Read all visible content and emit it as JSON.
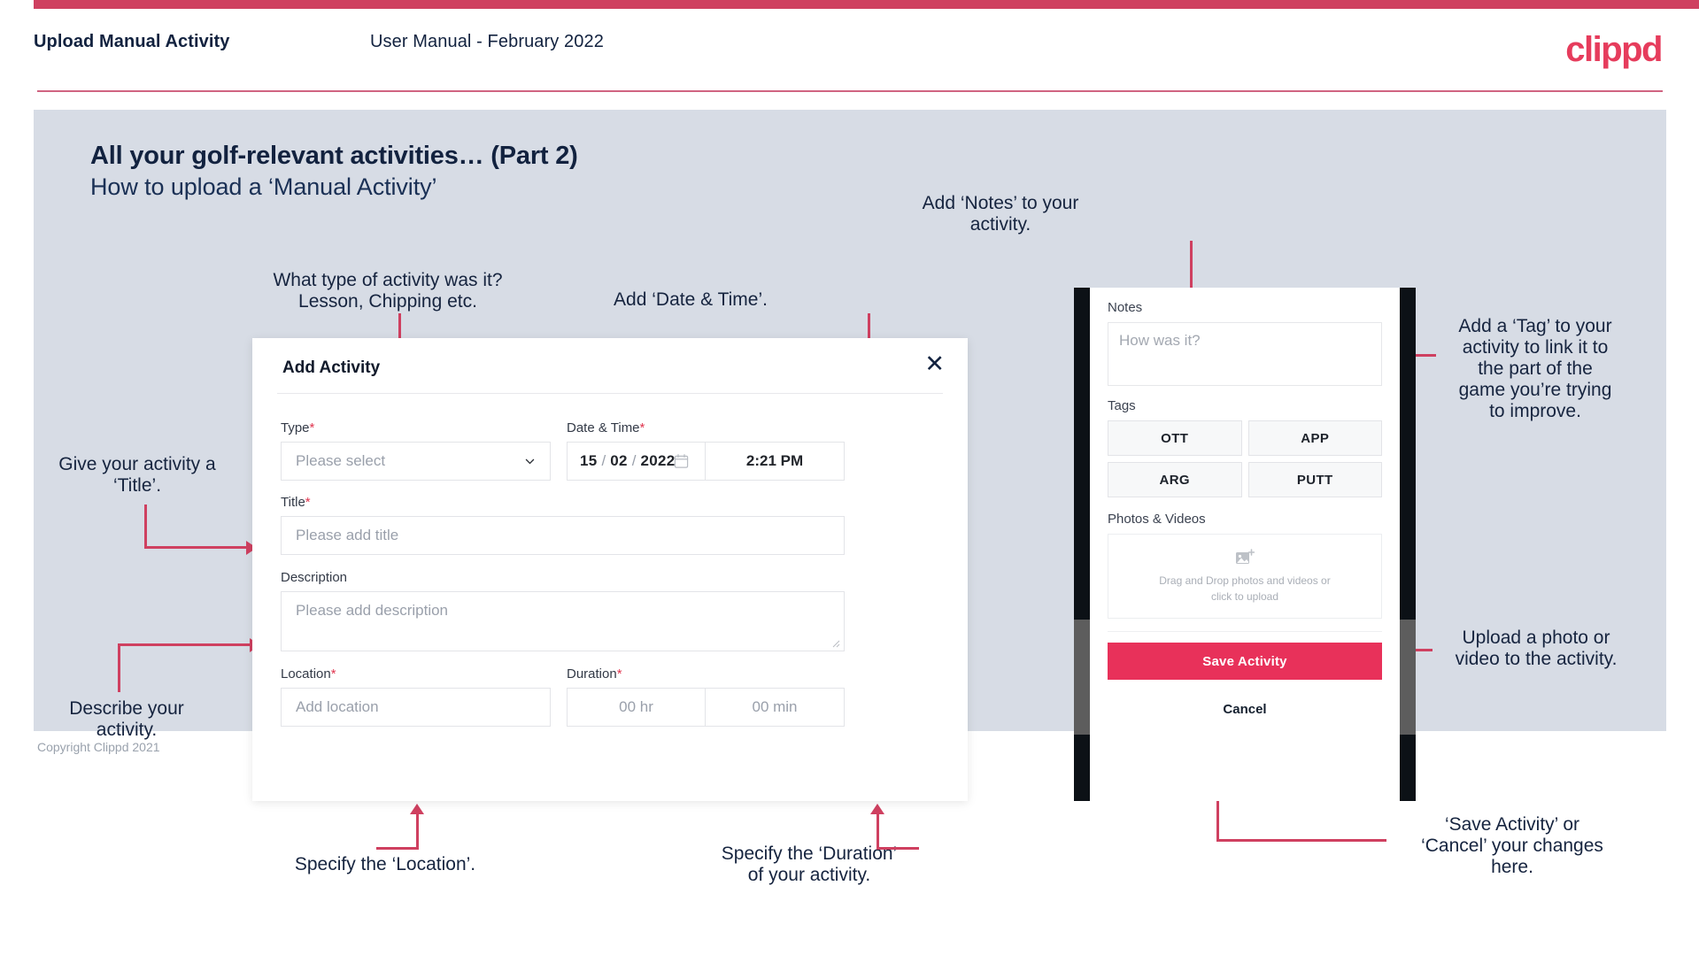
{
  "header": {
    "title": "Upload Manual Activity",
    "subtitle": "User Manual - February 2022",
    "logo": "clippd"
  },
  "slide": {
    "title": "All your golf-relevant activities… (Part 2)",
    "subtitle": "How to upload a ‘Manual Activity’",
    "copyright": "Copyright Clippd 2021"
  },
  "dialog": {
    "title": "Add Activity",
    "close_icon": "close-icon",
    "type": {
      "label": "Type",
      "required": "*",
      "placeholder": "Please select"
    },
    "datetime": {
      "label": "Date & Time",
      "required": "*",
      "day": "15",
      "month": "02",
      "year": "2022",
      "sep": "/",
      "time": "2:21 PM",
      "calendar_icon": "calendar-icon"
    },
    "title_field": {
      "label": "Title",
      "required": "*",
      "placeholder": "Please add title"
    },
    "description": {
      "label": "Description",
      "placeholder": "Please add description"
    },
    "location": {
      "label": "Location",
      "required": "*",
      "placeholder": "Add location"
    },
    "duration": {
      "label": "Duration",
      "required": "*",
      "hours": "00 hr",
      "minutes": "00 min"
    }
  },
  "phone": {
    "notes": {
      "label": "Notes",
      "placeholder": "How was it?"
    },
    "tags": {
      "label": "Tags",
      "items": [
        "OTT",
        "APP",
        "ARG",
        "PUTT"
      ]
    },
    "photos": {
      "label": "Photos & Videos",
      "icon": "add-image-icon",
      "line1": "Drag and Drop photos and videos or",
      "line2": "click to upload"
    },
    "save_label": "Save Activity",
    "cancel_label": "Cancel"
  },
  "annotations": {
    "type": "What type of activity was it?\nLesson, Chipping etc.",
    "datetime": "Add ‘Date & Time’.",
    "title": "Give your activity a\n‘Title’.",
    "description": "Describe your\nactivity.",
    "location": "Specify the ‘Location’.",
    "duration": "Specify the ‘Duration’\nof your activity.",
    "notes": "Add ‘Notes’ to your\nactivity.",
    "tags": "Add a ‘Tag’ to your\nactivity to link it to\nthe part of the\ngame you’re trying\nto improve.",
    "upload": "Upload a photo or\nvideo to the activity.",
    "save": "‘Save Activity’ or\n‘Cancel’ your changes\nhere."
  },
  "colors": {
    "accent": "#cf4060",
    "brand": "#e63c5c",
    "save": "#e8315a",
    "slide_bg": "#d7dce5",
    "ink": "#12223f"
  }
}
